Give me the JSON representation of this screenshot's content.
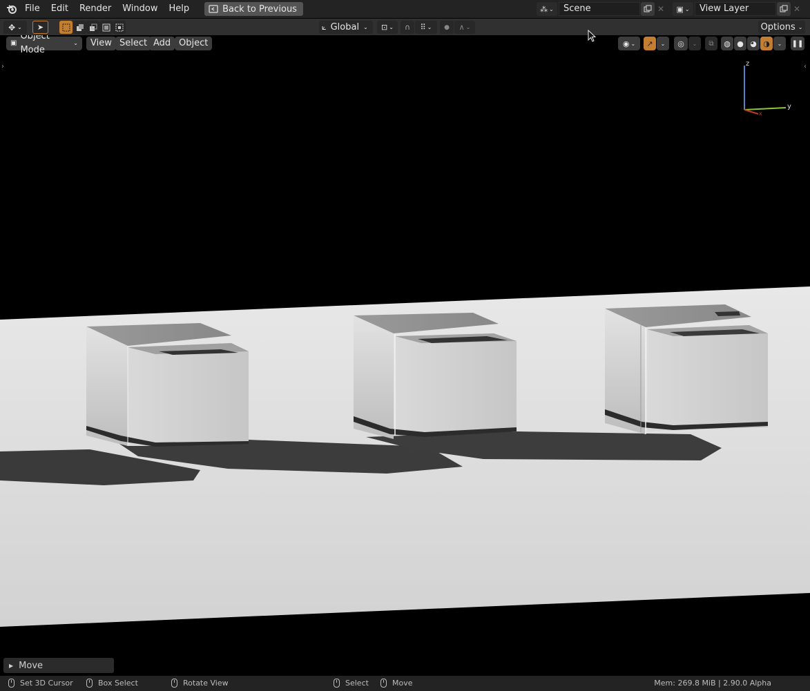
{
  "menu": {
    "items": [
      "File",
      "Edit",
      "Render",
      "Window",
      "Help"
    ],
    "back_label": "Back to Previous"
  },
  "scene": {
    "name": "Scene"
  },
  "view_layer": {
    "name": "View Layer"
  },
  "tool_header": {
    "orientation": "Global",
    "options_label": "Options"
  },
  "viewport_header": {
    "mode": "Object Mode",
    "menus": [
      "View",
      "Select",
      "Add",
      "Object"
    ]
  },
  "gizmo": {
    "z": "z",
    "y": "y",
    "x": "x"
  },
  "operator_panel": {
    "label": "Move"
  },
  "status_bar": {
    "hints": [
      {
        "label": "Set 3D Cursor"
      },
      {
        "label": "Box Select"
      },
      {
        "label": "Rotate View"
      },
      {
        "label": "Select"
      },
      {
        "label": "Move"
      }
    ],
    "memory": "Mem: 269.8 MiB | 2.90.0 Alpha"
  },
  "colors": {
    "accent": "#c47e32",
    "header": "#303030",
    "topbar": "#232323",
    "floor": "#d9d9d9"
  }
}
